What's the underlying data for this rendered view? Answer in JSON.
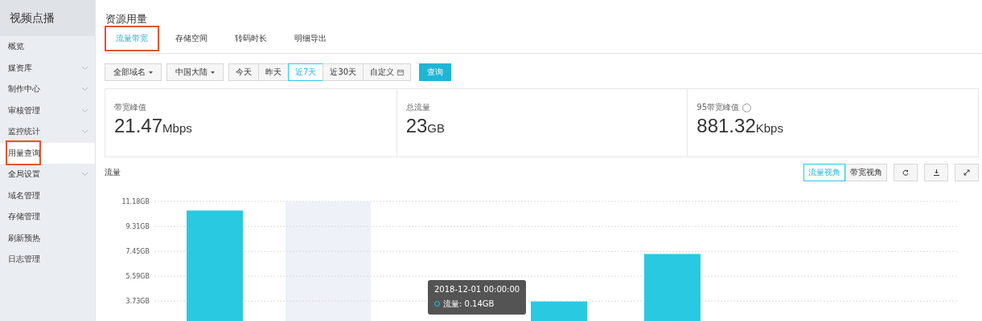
{
  "sidebar": {
    "title": "视频点播",
    "items": [
      {
        "label": "概览",
        "expandable": false,
        "selected": false,
        "highlighted": false
      },
      {
        "label": "媒资库",
        "expandable": true,
        "selected": false,
        "highlighted": false
      },
      {
        "label": "制作中心",
        "expandable": true,
        "selected": false,
        "highlighted": false
      },
      {
        "label": "审核管理",
        "expandable": true,
        "selected": false,
        "highlighted": false
      },
      {
        "label": "监控统计",
        "expandable": true,
        "selected": false,
        "highlighted": false
      },
      {
        "label": "用量查询",
        "expandable": false,
        "selected": true,
        "highlighted": true
      },
      {
        "label": "全局设置",
        "expandable": true,
        "selected": false,
        "highlighted": false
      },
      {
        "label": "域名管理",
        "expandable": false,
        "selected": false,
        "highlighted": false
      },
      {
        "label": "存储管理",
        "expandable": false,
        "selected": false,
        "highlighted": false
      },
      {
        "label": "刷新预热",
        "expandable": false,
        "selected": false,
        "highlighted": false
      },
      {
        "label": "日志管理",
        "expandable": false,
        "selected": false,
        "highlighted": false
      }
    ]
  },
  "page_title": "资源用量",
  "tabs": [
    {
      "label": "流量带宽",
      "selected": true,
      "highlighted": true
    },
    {
      "label": "存储空间",
      "selected": false,
      "highlighted": false
    },
    {
      "label": "转码时长",
      "selected": false,
      "highlighted": false
    },
    {
      "label": "明细导出",
      "selected": false,
      "highlighted": false
    }
  ],
  "filters": {
    "dropdowns": [
      "全部域名",
      "中国大陆"
    ],
    "ranges": [
      {
        "label": "今天",
        "selected": false,
        "kind": "text"
      },
      {
        "label": "昨天",
        "selected": false,
        "kind": "text"
      },
      {
        "label": "近7天",
        "selected": true,
        "kind": "text"
      },
      {
        "label": "近30天",
        "selected": false,
        "kind": "text"
      },
      {
        "label": "自定义",
        "selected": false,
        "kind": "calendar"
      }
    ],
    "query_button": "查询"
  },
  "stats": [
    {
      "label": "带宽峰值",
      "value": "21.47",
      "unit": "Mbps",
      "help": false
    },
    {
      "label": "总流量",
      "value": "23",
      "unit": "GB",
      "help": false
    },
    {
      "label": "95带宽峰值",
      "value": "881.32",
      "unit": "Kbps",
      "help": true
    }
  ],
  "chart": {
    "title": "流量",
    "views": [
      {
        "label": "流量视角",
        "selected": true
      },
      {
        "label": "带宽视角",
        "selected": false
      }
    ],
    "tooltip": {
      "time": "2018-12-01 00:00:00",
      "separator": ":",
      "value": "0.14GB"
    },
    "chart_data": {
      "type": "bar",
      "grid": true,
      "ylim": [
        0,
        11.18
      ],
      "yticks": [
        {
          "value": 3.73,
          "label": "3.73GB"
        },
        {
          "value": 5.59,
          "label": "5.59GB"
        },
        {
          "value": 7.45,
          "label": "7.45GB"
        },
        {
          "value": 9.31,
          "label": "9.31GB"
        },
        {
          "value": 11.18,
          "label": "11.18GB"
        }
      ],
      "series": [
        {
          "name": "流量",
          "color": "#29c9e2",
          "values": [
            10.5,
            null,
            null,
            3.7,
            7.25,
            null,
            null
          ]
        }
      ]
    }
  }
}
